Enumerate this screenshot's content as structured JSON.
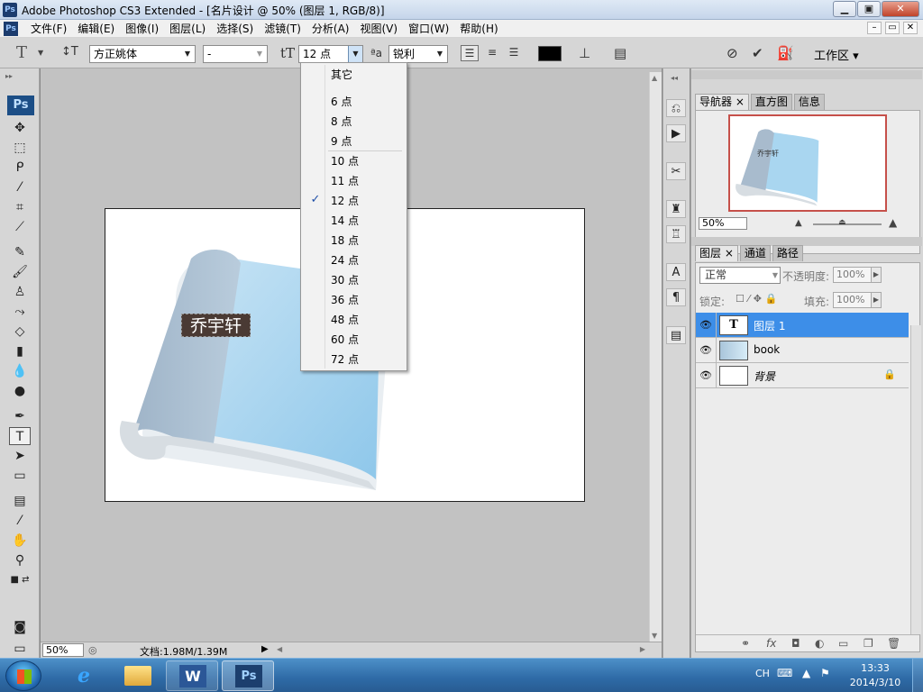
{
  "window": {
    "app_icon": "Ps",
    "title": "Adobe Photoshop CS3 Extended - [名片设计 @ 50% (图层 1, RGB/8)]",
    "minimize": "▁",
    "maximize": "▣",
    "close": "✕"
  },
  "menubar": {
    "items": [
      "文件(F)",
      "编辑(E)",
      "图像(I)",
      "图层(L)",
      "选择(S)",
      "滤镜(T)",
      "分析(A)",
      "视图(V)",
      "窗口(W)",
      "帮助(H)"
    ],
    "doc_min": "–",
    "doc_restore": "▭",
    "doc_close": "✕"
  },
  "options": {
    "font_family": "方正姚体",
    "font_style": "-",
    "font_size": "12 点",
    "antialias": "锐利",
    "workspace_label": "工作区 ▾",
    "color": "#000000"
  },
  "size_menu": {
    "other": "其它",
    "sizes": [
      "6 点",
      "8 点",
      "9 点",
      "10 点",
      "11 点",
      "12 点",
      "14 点",
      "18 点",
      "24 点",
      "30 点",
      "36 点",
      "48 点",
      "60 点",
      "72 点"
    ],
    "selected": "12 点",
    "check": "✓"
  },
  "canvas": {
    "text_layer": "乔宇轩"
  },
  "statusbar": {
    "zoom": "50%",
    "doc_info": "文档:1.98M/1.39M"
  },
  "navigator": {
    "tabs": [
      "导航器 ×",
      "直方图",
      "信息"
    ],
    "zoom": "50%",
    "thumb_text": "乔宇轩"
  },
  "layers": {
    "tabs": [
      "图层 ×",
      "通道",
      "路径"
    ],
    "blend_mode": "正常",
    "opacity_label": "不透明度:",
    "opacity": "100%",
    "lock_label": "锁定:",
    "fill_label": "填充:",
    "fill": "100%",
    "items": [
      {
        "name": "图层 1",
        "thumb": "T",
        "selected": true
      },
      {
        "name": "book",
        "thumb": "",
        "selected": false
      },
      {
        "name": "背景",
        "thumb": "",
        "selected": false
      }
    ]
  },
  "taskbar": {
    "lang": "CH",
    "time": "13:33",
    "date": "2014/3/10"
  }
}
